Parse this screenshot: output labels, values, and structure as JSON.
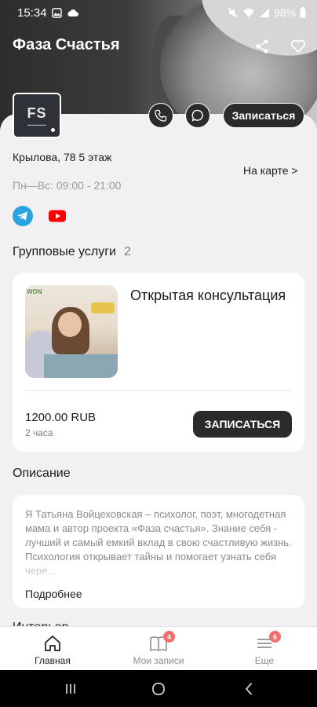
{
  "status_bar": {
    "time": "15:34",
    "battery": "98%"
  },
  "header": {
    "title": "Фаза Счастья"
  },
  "profile": {
    "logo_text": "FS",
    "book_label": "Записаться",
    "address": "Крылова, 78 5 этаж",
    "map_link": "На карте >",
    "hours": "Пн—Вс: 09:00 - 21:00"
  },
  "group_services": {
    "title": "Групповые услуги",
    "count": "2",
    "items": [
      {
        "name": "Открытая консультация",
        "price": "1200.00 RUB",
        "duration": "2 часа",
        "button": "ЗАПИСАТЬСЯ"
      }
    ]
  },
  "description": {
    "title": "Описание",
    "text": "Я Татьяна Войцеховская – психолог, поэт, многодетная мама и автор проекта «Фаза счастья». Знание себя - лучший и самый емкий вклад в свою счастливую жизнь. Психология открывает тайны и помогает узнать себя чере...",
    "more": "Подробнее"
  },
  "next_section_cut": "Интерьер",
  "bottom_nav": {
    "items": [
      {
        "label": "Главная",
        "icon": "home-icon"
      },
      {
        "label": "Мои записи",
        "icon": "book-icon",
        "badge": "4"
      },
      {
        "label": "Еще",
        "icon": "menu-icon",
        "badge": "6"
      }
    ]
  },
  "colors": {
    "dark": "#2b2b2d",
    "badge": "#f26d6d",
    "telegram": "#2aa3e0",
    "youtube": "#ff0000"
  }
}
